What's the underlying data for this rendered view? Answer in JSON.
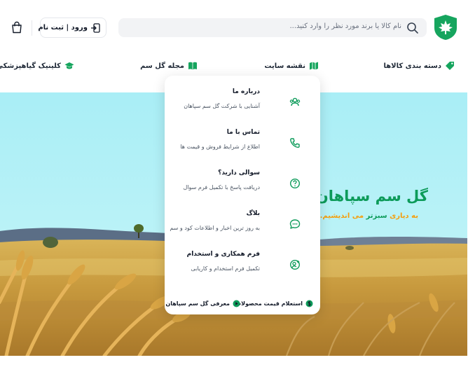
{
  "search": {
    "placeholder": "نام کالا یا برند مورد نظر را وارد کنید..."
  },
  "header": {
    "login_label": "ورود | ثبت نام"
  },
  "nav": {
    "items": [
      {
        "label": "دسته بندی کالاها",
        "icon": "tag-icon"
      },
      {
        "label": "نقشه سایت",
        "icon": "map-icon"
      },
      {
        "label": "مجله گل سم",
        "icon": "book-icon"
      },
      {
        "label": "کلینیک گیاهپزشکی",
        "icon": "graduation-cap-icon"
      }
    ]
  },
  "dropdown": {
    "items": [
      {
        "title": "درباره ما",
        "desc": "آشنایی با شرکت گل سم سپاهان",
        "icon": "users-icon"
      },
      {
        "title": "تماس با ما",
        "desc": "اطلاع از شرایط فروش و قیمت ها",
        "icon": "phone-icon"
      },
      {
        "title": "سوالی دارید؟",
        "desc": "دریافت پاسخ با تکمیل فرم سوال",
        "icon": "question-icon"
      },
      {
        "title": "بلاگ",
        "desc": "به روز ترین اخبار و اطلاعات کود و سم",
        "icon": "chat-icon"
      },
      {
        "title": "فرم همکاری و استخدام",
        "desc": "تکمیل فرم استخدام و کاریابی",
        "icon": "user-add-icon"
      }
    ],
    "footer": [
      {
        "label": "استعلام قیمت محصولات",
        "icon": "dollar-icon"
      },
      {
        "label": "معرفی گل سم سپاهان",
        "icon": "play-icon"
      }
    ]
  },
  "hero": {
    "title": "گل سم سپاهان",
    "subtitle_prefix": "به دیاری",
    "subtitle_accent": "سبزتر",
    "subtitle_suffix": "می اندیشیم..."
  },
  "colors": {
    "brand_green": "#0d9b5a",
    "accent_orange": "#f59e0b",
    "sky": "#b8f2f8"
  }
}
